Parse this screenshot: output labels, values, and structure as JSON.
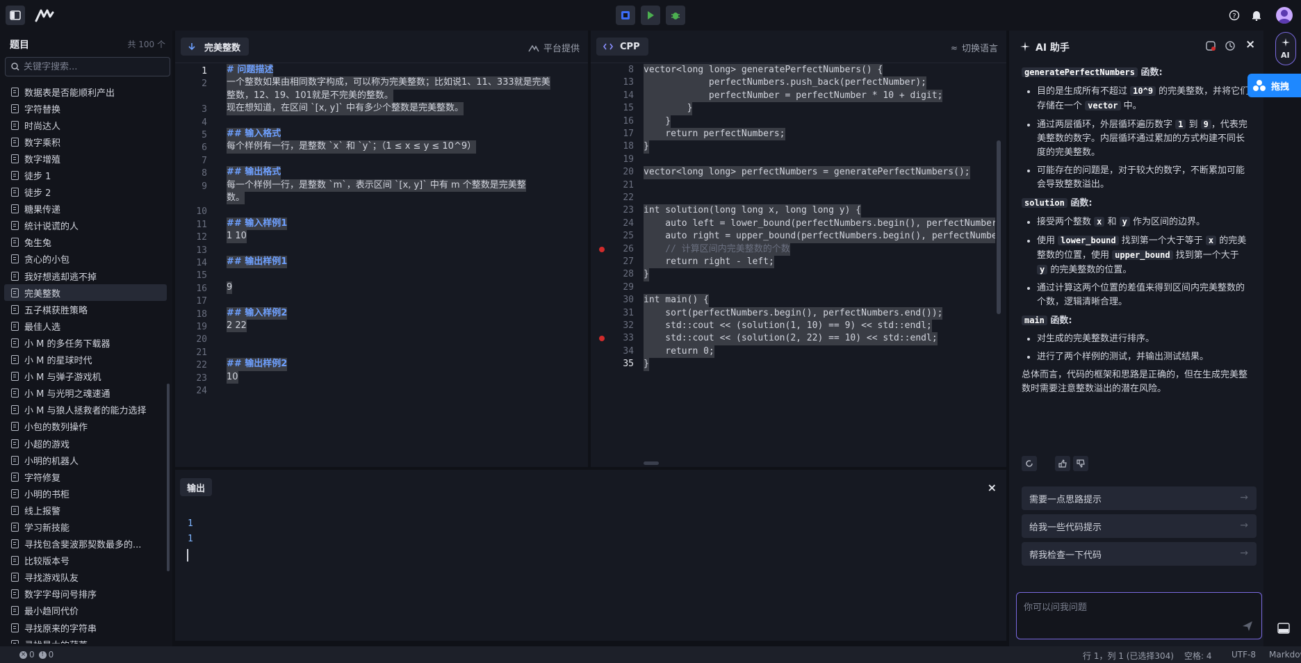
{
  "sidebar": {
    "title": "题目",
    "count": "共 100 个",
    "search_placeholder": "关键字搜索...",
    "items": [
      {
        "label": "数据表是否能顺利产出"
      },
      {
        "label": "字符替换"
      },
      {
        "label": "时尚达人"
      },
      {
        "label": "数字乘积"
      },
      {
        "label": "数字增殖"
      },
      {
        "label": "徒步 1"
      },
      {
        "label": "徒步 2"
      },
      {
        "label": "糖果传递"
      },
      {
        "label": "统计说谎的人"
      },
      {
        "label": "兔生兔"
      },
      {
        "label": "贪心的小包"
      },
      {
        "label": "我好想逃却逃不掉"
      },
      {
        "label": "完美整数"
      },
      {
        "label": "五子棋获胜策略"
      },
      {
        "label": "最佳人选"
      },
      {
        "label": "小 M 的多任务下载器"
      },
      {
        "label": "小 M 的星球时代"
      },
      {
        "label": "小 M 与弹子游戏机"
      },
      {
        "label": "小 M 与光明之魂速通"
      },
      {
        "label": "小 M 与狼人拯救者的能力选择"
      },
      {
        "label": "小包的数列操作"
      },
      {
        "label": "小超的游戏"
      },
      {
        "label": "小明的机器人"
      },
      {
        "label": "字符修复"
      },
      {
        "label": "小明的书柜"
      },
      {
        "label": "线上报警"
      },
      {
        "label": "学习新技能"
      },
      {
        "label": "寻找包含斐波那契数最多的..."
      },
      {
        "label": "比较版本号"
      },
      {
        "label": "寻找游戏队友"
      },
      {
        "label": "数字字母问号排序"
      },
      {
        "label": "最小趋同代价"
      },
      {
        "label": "寻找原来的字符串"
      },
      {
        "label": "寻找最大的葫芦"
      }
    ]
  },
  "problem": {
    "tab": "完美整数",
    "source": "平台提供",
    "line_numbers": [
      "1",
      "2",
      "",
      "3",
      "4",
      "5",
      "6",
      "7",
      "8",
      "9",
      "",
      "10",
      "11",
      "12",
      "13",
      "14",
      "15",
      "16",
      "17",
      "18",
      "19",
      "20",
      "21",
      "22",
      "23",
      "24"
    ],
    "lines": [
      {
        "hl": "# 问题描述",
        "cls": "md-h"
      },
      {
        "hl": "一个整数如果由相同数字构成，可以称为完美整数；比如说1、11、333就是完美",
        "cls": "md-t"
      },
      {
        "hl": "整数，12、19、101就是不完美的整数。",
        "cls": "md-t"
      },
      {
        "hl": "现在想知道，在区间 `[x, y]` 中有多少个整数是完美整数。",
        "cls": "md-t"
      },
      {
        "hl": "",
        "cls": "md-t"
      },
      {
        "hl": "## 输入格式",
        "cls": "md-h"
      },
      {
        "hl": "每个样例有一行，是整数 `x` 和 `y`；（1 ≤ x ≤ y ≤ 10^9）",
        "cls": "md-t"
      },
      {
        "hl": "",
        "cls": "md-t"
      },
      {
        "hl": "## 输出格式",
        "cls": "md-h"
      },
      {
        "hl": "每一个样例一行，是整数 `m`，表示区间 `[x, y]` 中有 m 个整数是完美整",
        "cls": "md-t"
      },
      {
        "hl": "数。",
        "cls": "md-t"
      },
      {
        "hl": "",
        "cls": "md-t"
      },
      {
        "hl": "## 输入样例1",
        "cls": "md-h"
      },
      {
        "hl": "1 10",
        "cls": "md-t"
      },
      {
        "hl": "",
        "cls": "md-t"
      },
      {
        "hl": "## 输出样例1",
        "cls": "md-h"
      },
      {
        "hl": "",
        "cls": "md-t"
      },
      {
        "hl": "9",
        "cls": "md-t"
      },
      {
        "hl": "",
        "cls": "md-t"
      },
      {
        "hl": "## 输入样例2",
        "cls": "md-h"
      },
      {
        "hl": "2 22",
        "cls": "md-t"
      },
      {
        "hl": "",
        "cls": "md-t"
      },
      {
        "hl": "",
        "cls": "md-t"
      },
      {
        "hl": "## 输出样例2",
        "cls": "md-h"
      },
      {
        "hl": "10",
        "cls": "md-t"
      },
      {
        "hl": "",
        "cls": "md-t"
      }
    ]
  },
  "editor": {
    "tab": "CPP",
    "switch": "切换语言",
    "header_line": "vector<long long> generatePerfectNumbers() {",
    "line_numbers": [
      "8",
      "13",
      "14",
      "15",
      "16",
      "17",
      "18",
      "19",
      "20",
      "21",
      "22",
      "23",
      "24",
      "25",
      "26",
      "27",
      "28",
      "29",
      "30",
      "31",
      "32",
      "33",
      "34",
      "35"
    ],
    "code": [
      "vector<long long> generatePerfectNumbers() {",
      "            perfectNumbers.push_back(perfectNumber);",
      "            perfectNumber = perfectNumber * 10 + digit;",
      "        }",
      "    }",
      "    return perfectNumbers;",
      "}",
      "",
      "vector<long long> perfectNumbers = generatePerfectNumbers();",
      "",
      "",
      "int solution(long long x, long long y) {",
      "    auto left = lower_bound(perfectNumbers.begin(), perfectNumbers",
      "    auto right = upper_bound(perfectNumbers.begin(), perfectNumbers",
      "    // 计算区间内完美整数的个数",
      "    return right - left;",
      "}",
      "",
      "int main() {",
      "    sort(perfectNumbers.begin(), perfectNumbers.end());",
      "    std::cout << (solution(1, 10) == 9) << std::endl;",
      "    std::cout << (solution(2, 22) == 10) << std::endl;",
      "    return 0;",
      "}"
    ]
  },
  "output": {
    "tab": "输出",
    "lines": [
      "1",
      "1"
    ]
  },
  "ai": {
    "title": "AI 助手",
    "section1_code": "generatePerfectNumbers",
    "section1_suffix": " 函数:",
    "s1_b1_pre": "目的是生成所有不超过 ",
    "s1_b1_code": "10^9",
    "s1_b1_mid": " 的完美整数，并将它们存储在一个 ",
    "s1_b1_code2": "vector",
    "s1_b1_post": " 中。",
    "s1_b2_pre": "通过两层循环，外层循环遍历数字 ",
    "s1_b2_code": "1",
    "s1_b2_mid": " 到 ",
    "s1_b2_code2": "9",
    "s1_b2_post": "，代表完美整数的数字。内层循环通过累加的方式构建不同长度的完美整数。",
    "s1_b3": "可能存在的问题是，对于较大的数字，不断累加可能会导致整数溢出。",
    "section2_code": "solution",
    "section2_suffix": " 函数:",
    "s2_b1_pre": "接受两个整数 ",
    "s2_b1_code": "x",
    "s2_b1_mid": " 和 ",
    "s2_b1_code2": "y",
    "s2_b1_post": " 作为区间的边界。",
    "s2_b2_pre": "使用 ",
    "s2_b2_code": "lower_bound",
    "s2_b2_mid": " 找到第一个大于等于 ",
    "s2_b2_code2": "x",
    "s2_b2_mid2": " 的完美整数的位置，使用 ",
    "s2_b2_code3": "upper_bound",
    "s2_b2_mid3": " 找到第一个大于 ",
    "s2_b2_code4": "y",
    "s2_b2_post": " 的完美整数的位置。",
    "s2_b3": "通过计算这两个位置的差值来得到区间内完美整数的个数，逻辑清晰合理。",
    "section3_code": "main",
    "section3_suffix": " 函数:",
    "s3_b1": "对生成的完美整数进行排序。",
    "s3_b2": "进行了两个样例的测试，并输出测试结果。",
    "summary": "总体而言，代码的框架和思路是正确的，但在生成完美整数时需要注意整数溢出的潜在风险。",
    "suggestions": [
      "需要一点思路提示",
      "给我一些代码提示",
      "帮我检查一下代码"
    ],
    "input_placeholder": "你可以问我问题"
  },
  "floating": {
    "drag_label": "拖拽"
  },
  "strip": {
    "ai_label": "AI"
  },
  "status": {
    "errors": "0",
    "warnings": "0",
    "position": "行 1，列 1 (已选择304)",
    "spaces": "空格: 4",
    "encoding": "UTF-8",
    "language": "Markdown"
  },
  "colors": {
    "accent": "#3b6cf6",
    "run": "#4caf50",
    "breakpoint": "#d02b2b"
  }
}
